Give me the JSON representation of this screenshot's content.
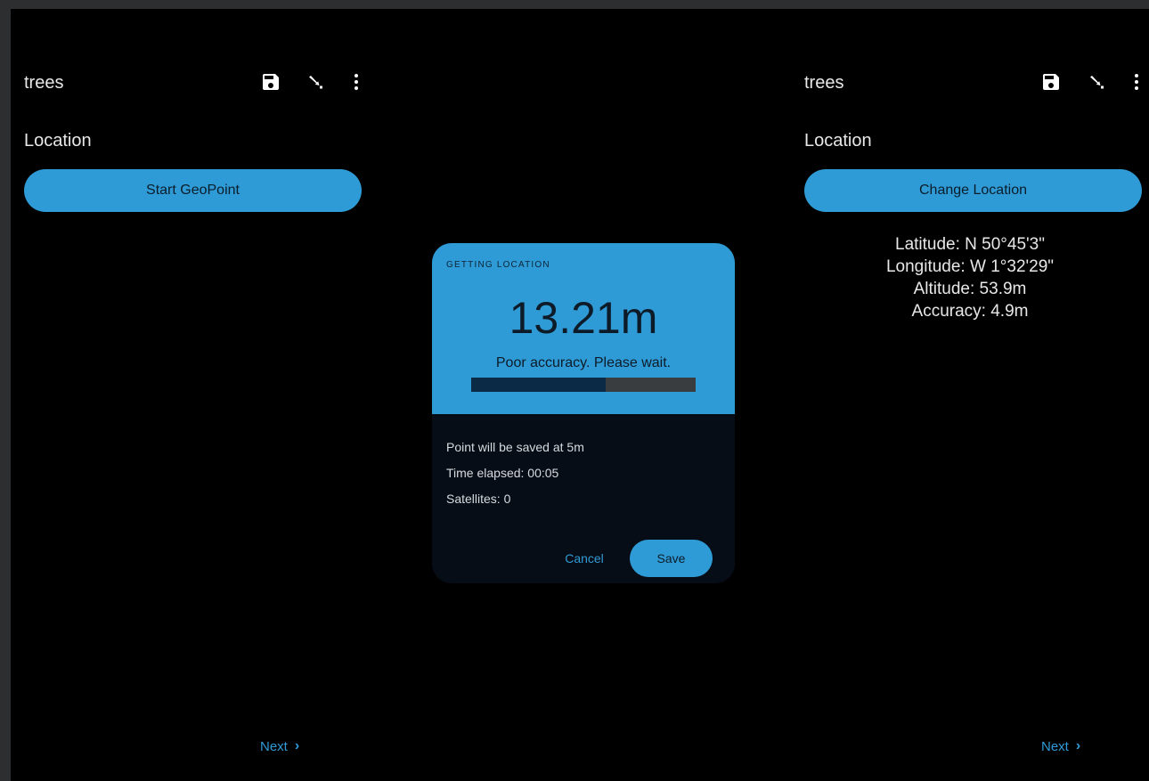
{
  "left_screen": {
    "toolbar": {
      "title": "trees",
      "icons": [
        "save-icon",
        "go-to-icon",
        "more-vert-icon"
      ]
    },
    "section_label": "Location",
    "primary_button_label": "Start GeoPoint",
    "next_label": "Next"
  },
  "dialog": {
    "caption": "GETTING LOCATION",
    "accuracy": "13.21m",
    "status": "Poor accuracy. Please wait.",
    "progress_fraction": 0.6,
    "info_lines": [
      "Point will be saved at 5m",
      "Time elapsed: 00:05",
      "Satellites: 0"
    ],
    "cancel_label": "Cancel",
    "save_label": "Save"
  },
  "right_screen": {
    "toolbar": {
      "title": "trees",
      "icons": [
        "save-icon",
        "go-to-icon",
        "more-vert-icon"
      ]
    },
    "section_label": "Location",
    "primary_button_label": "Change Location",
    "coordinates": {
      "latitude": "Latitude: N 50°45'3\"",
      "longitude": "Longitude: W 1°32'29\"",
      "altitude": "Altitude: 53.9m",
      "accuracy": "Accuracy: 4.9m"
    },
    "next_label": "Next"
  },
  "colors": {
    "accent": "#2f9bd6",
    "background": "#000000",
    "dialog_body": "#070d16",
    "text": "#e8e8e8"
  }
}
